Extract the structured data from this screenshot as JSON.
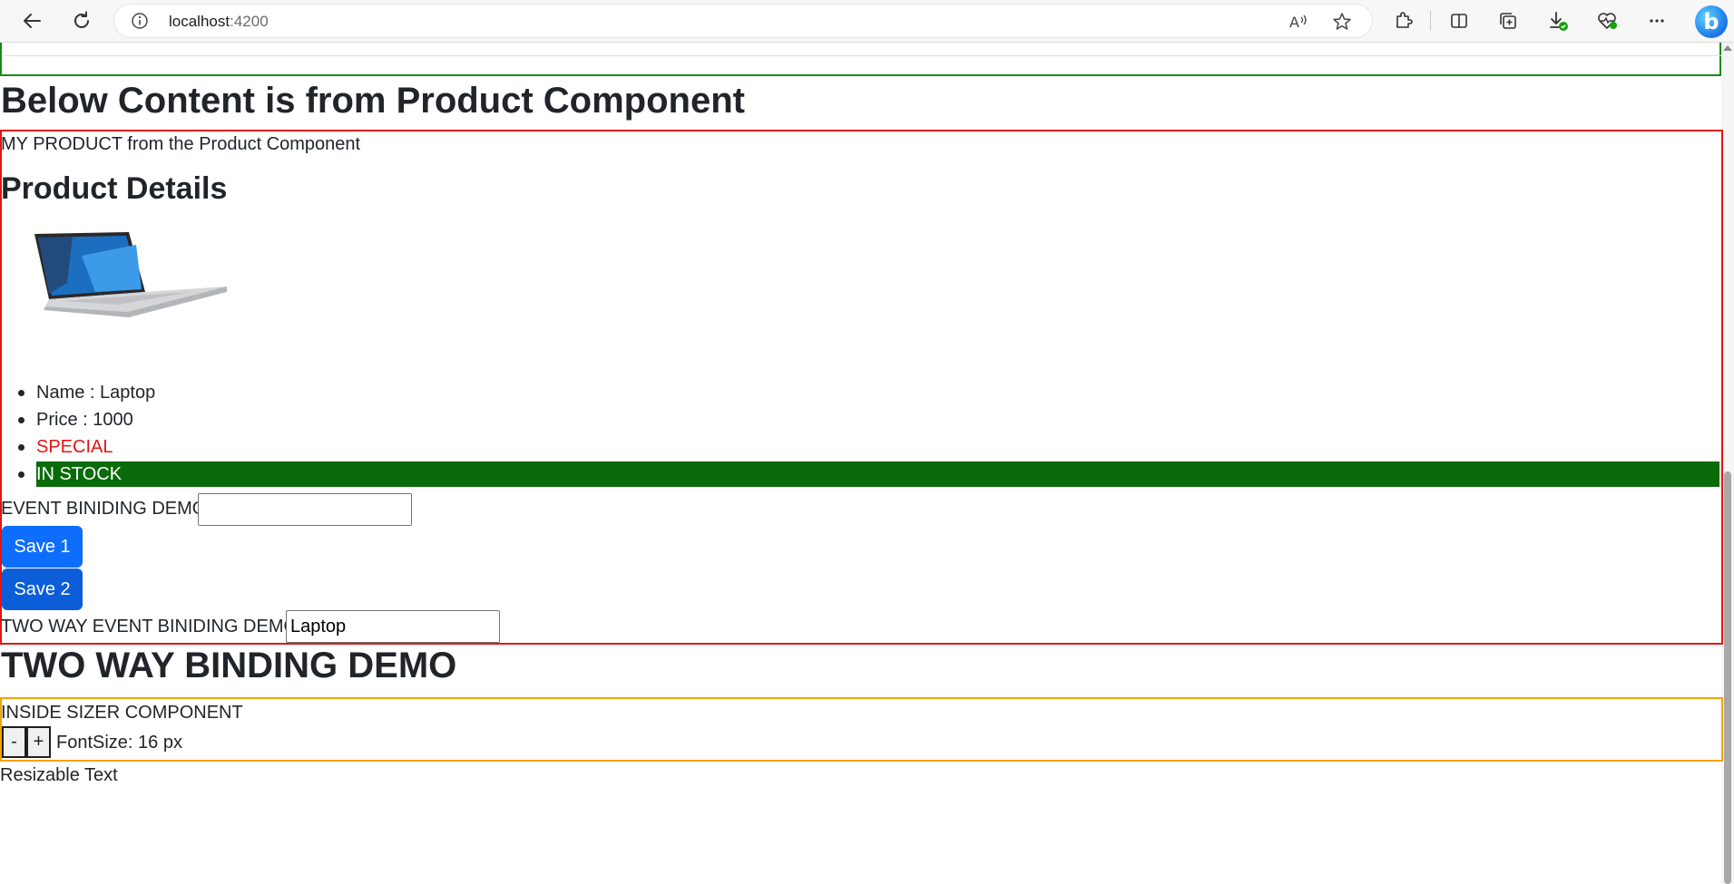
{
  "browser": {
    "url_host": "localhost",
    "url_port": ":4200"
  },
  "page": {
    "product_heading": "Below Content is from Product Component",
    "my_product_text": "MY PRODUCT from the Product Component",
    "product_details_heading": "Product Details",
    "product_list": {
      "name": "Name : Laptop",
      "price": "Price : 1000",
      "special": "SPECIAL",
      "stock": "IN STOCK"
    },
    "event_binding_label": "EVENT BINIDING DEMO",
    "event_binding_value": "",
    "save1_label": "Save 1",
    "save2_label": "Save 2",
    "two_way_event_label": "TWO WAY EVENT BINIDING DEMO",
    "two_way_event_value": "Laptop",
    "two_way_heading": "TWO WAY BINDING DEMO",
    "sizer": {
      "title": "INSIDE SIZER COMPONENT",
      "decrement_label": "-",
      "increment_label": "+",
      "font_size_text": "FontSize: 16 px"
    },
    "resizable_text": "Resizable Text"
  },
  "colors": {
    "product_border": "#e31414",
    "top_border": "#168a16",
    "sizer_border": "#f0a500",
    "special_text": "#e31414",
    "in_stock_bg": "#096b09",
    "primary_button": "#0d6efd"
  }
}
